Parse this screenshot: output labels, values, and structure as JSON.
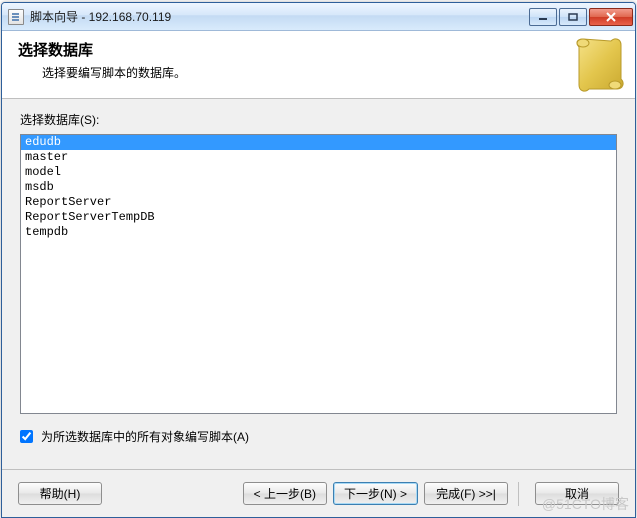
{
  "window": {
    "title": "脚本向导 - 192.168.70.119"
  },
  "header": {
    "title": "选择数据库",
    "subtitle": "选择要编写脚本的数据库。"
  },
  "body": {
    "list_label": "选择数据库(S):",
    "databases": [
      "edudb",
      "master",
      "model",
      "msdb",
      "ReportServer",
      "ReportServerTempDB",
      "tempdb"
    ],
    "selected_index": 0,
    "checkbox_label": "为所选数据库中的所有对象编写脚本(A)",
    "checkbox_checked": true
  },
  "buttons": {
    "help": "帮助(H)",
    "back": "< 上一步(B)",
    "next": "下一步(N) >",
    "finish": "完成(F) >>|",
    "cancel": "取消"
  },
  "watermark": "@51CTO博客"
}
